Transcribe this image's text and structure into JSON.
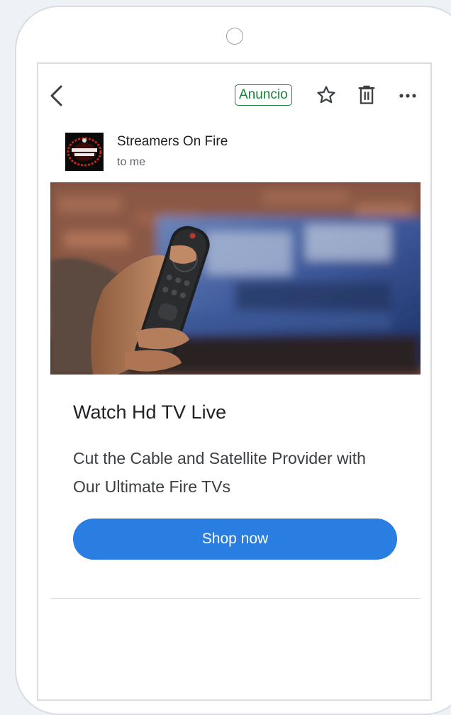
{
  "toolbar": {
    "back_icon": "chevron-left-icon",
    "ad_label": "Anuncio",
    "star_icon": "star-outline-icon",
    "trash_icon": "trash-icon",
    "more_icon": "more-horizontal-icon"
  },
  "message": {
    "sender_name": "Streamers On Fire",
    "recipient": "to me",
    "headline": "Watch Hd TV Live",
    "body": "Cut the Cable and Satellite Provider with Our Ultimate Fire TVs",
    "cta_label": "Shop now"
  },
  "colors": {
    "accent": "#2a7de1",
    "ad_badge": "#188038",
    "text_primary": "#202124",
    "text_secondary": "#5f6368"
  }
}
